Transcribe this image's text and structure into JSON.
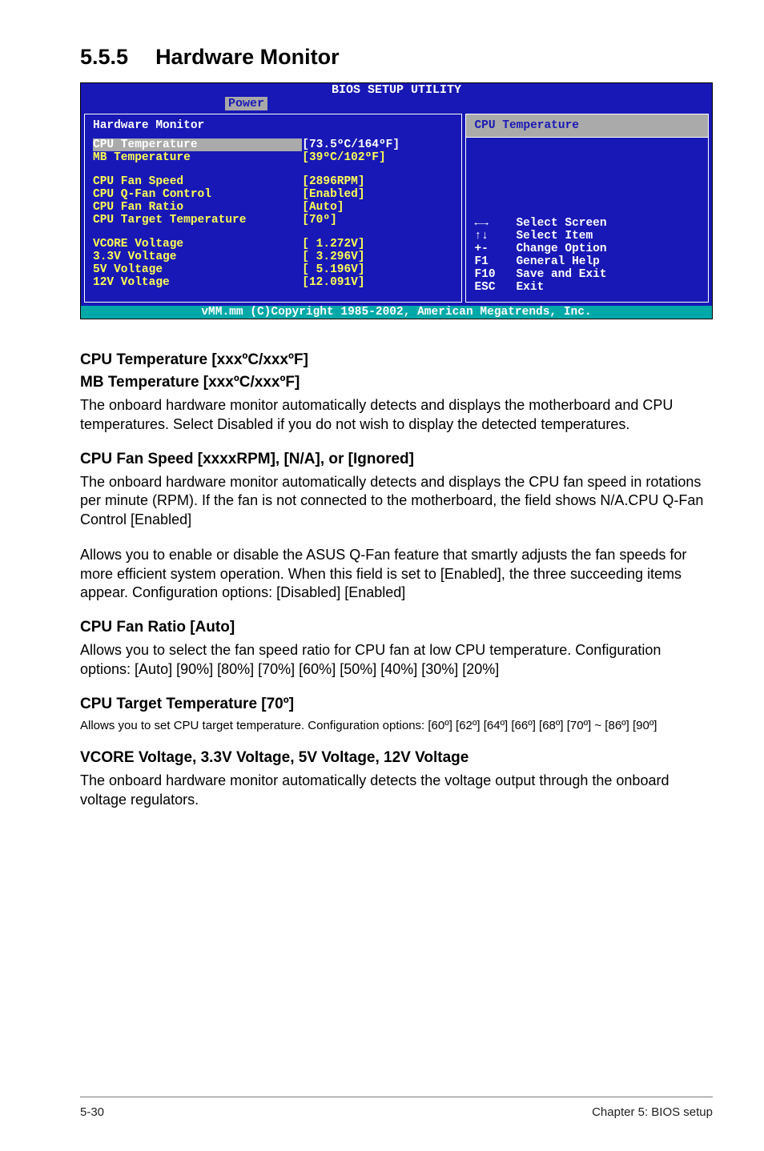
{
  "heading": {
    "number": "5.5.5",
    "title": "Hardware Monitor"
  },
  "bios": {
    "topTitle": "BIOS SETUP UTILITY",
    "tab": "Power",
    "leftTitle": "Hardware Monitor",
    "groups": [
      [
        {
          "label": "CPU Temperature",
          "value": "[73.5ºC/164ºF]",
          "sel": true
        },
        {
          "label": "MB Temperature",
          "value": "[39ºC/102ºF]"
        }
      ],
      [
        {
          "label": "CPU Fan Speed",
          "value": "[2896RPM]"
        },
        {
          "label": "CPU Q-Fan Control",
          "value": "[Enabled]"
        },
        {
          "label": "CPU Fan Ratio",
          "value": "[Auto]"
        },
        {
          "label": "CPU Target Temperature",
          "value": "[70º]"
        }
      ],
      [
        {
          "label": "VCORE Voltage",
          "value": "[ 1.272V]"
        },
        {
          "label": "3.3V Voltage",
          "value": "[ 3.296V]"
        },
        {
          "label": "5V Voltage",
          "value": "[ 5.196V]"
        },
        {
          "label": "12V Voltage",
          "value": "[12.091V]"
        }
      ]
    ],
    "helpTitle": "CPU Temperature",
    "nav": [
      {
        "key": "←→",
        "desc": "Select Screen"
      },
      {
        "key": "↑↓",
        "desc": "Select Item"
      },
      {
        "key": "+-",
        "desc": "Change Option"
      },
      {
        "key": "F1",
        "desc": "General Help"
      },
      {
        "key": "F10",
        "desc": "Save and Exit"
      },
      {
        "key": "ESC",
        "desc": "Exit"
      }
    ],
    "footer": "vMM.mm (C)Copyright 1985-2002, American Megatrends, Inc."
  },
  "sections": [
    {
      "heads": [
        "CPU Temperature [xxxºC/xxxºF]",
        "MB Temperature [xxxºC/xxxºF]"
      ],
      "paras": [
        "The onboard hardware monitor automatically detects and displays the motherboard and CPU temperatures. Select Disabled if you do not wish to display the detected temperatures."
      ]
    },
    {
      "heads": [
        "CPU Fan Speed [xxxxRPM], [N/A], or [Ignored]"
      ],
      "paras": [
        "The onboard hardware monitor automatically detects and displays the CPU fan speed in rotations per minute (RPM). If the fan is not connected to the motherboard, the field shows N/A.CPU Q-Fan Control [Enabled]",
        "Allows you to enable or disable the ASUS Q-Fan feature that smartly adjusts the fan speeds for more efficient system operation. When this field is set to [Enabled], the three succeeding items appear. Configuration options: [Disabled] [Enabled]"
      ]
    },
    {
      "heads": [
        "CPU Fan Ratio [Auto]"
      ],
      "paras": [
        "Allows you to select the fan speed ratio for CPU fan at low CPU temperature. Configuration options: [Auto] [90%] [80%] [70%] [60%] [50%] [40%] [30%] [20%]"
      ]
    },
    {
      "heads": [
        "CPU Target Temperature [70º]"
      ],
      "paras": [
        "Allows you to set CPU target temperature. Configuration options: [60º] [62º] [64º] [66º] [68º] [70º] ~ [86º] [90º]"
      ],
      "smaller": true
    },
    {
      "heads": [
        "VCORE Voltage, 3.3V Voltage, 5V Voltage, 12V Voltage"
      ],
      "paras": [
        "The onboard hardware monitor automatically detects the voltage output through the onboard voltage regulators."
      ]
    }
  ],
  "footer": {
    "left": "5-30",
    "right": "Chapter 5: BIOS setup"
  }
}
